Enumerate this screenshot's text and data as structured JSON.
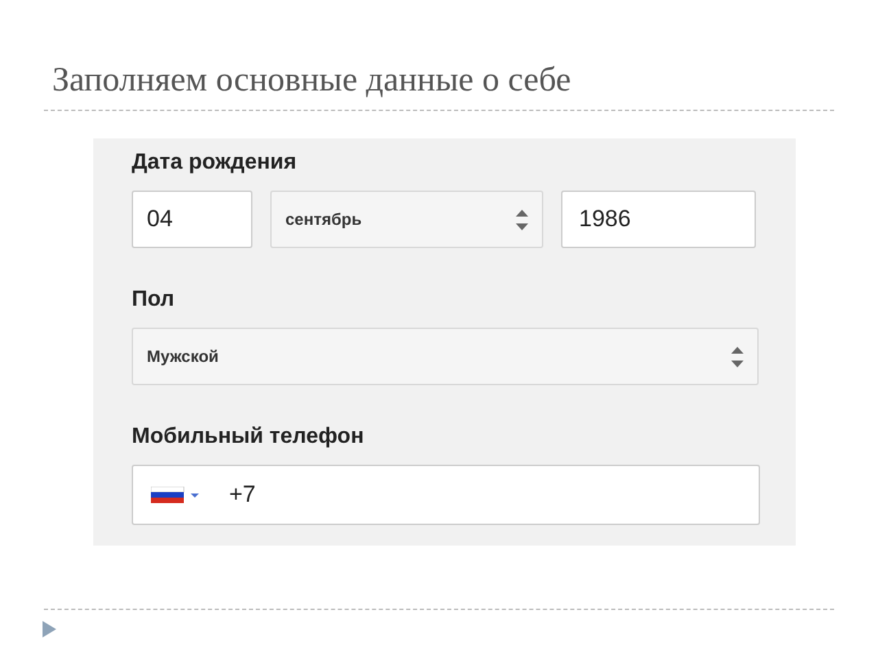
{
  "slide": {
    "title": "Заполняем основные данные о себе"
  },
  "form": {
    "birth_date": {
      "label": "Дата рождения",
      "day": "04",
      "month": "сентябрь",
      "year": "1986"
    },
    "gender": {
      "label": "Пол",
      "value": "Мужской"
    },
    "phone": {
      "label": "Мобильный телефон",
      "value": "+7"
    }
  }
}
